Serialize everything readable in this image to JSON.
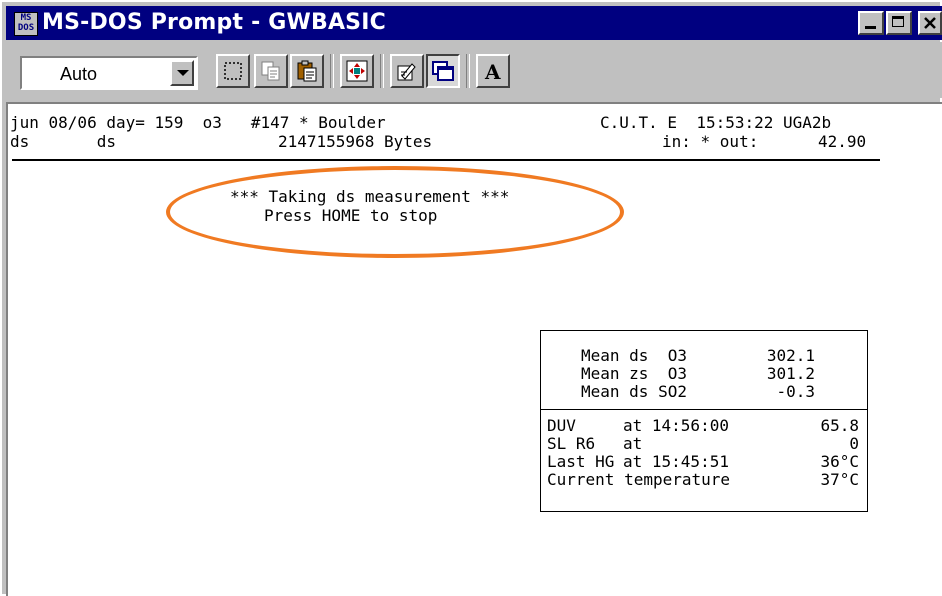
{
  "window": {
    "title": "MS-DOS Prompt - GWBASIC",
    "icon_label_top": "MS",
    "icon_label_bottom": "DOS",
    "title_bg": "#000080"
  },
  "toolbar": {
    "font_select_value": "Auto",
    "tools": [
      "mark-icon",
      "copy-icon",
      "paste-icon",
      "fullscreen-icon",
      "properties-icon",
      "background-icon",
      "font-icon"
    ],
    "font_tool_label": "A"
  },
  "status": {
    "line1_left": "jun 08/06 day= 159  o3   #147 * Boulder",
    "line1_right": "C.U.T. E  15:53:22 UGA2b",
    "line2_left": "ds       ds",
    "line2_bytes": "2147155968 Bytes",
    "line2_right": "in: * out:",
    "line2_value": "42.90"
  },
  "message": {
    "line1": "*** Taking ds measurement ***",
    "line2": "Press HOME to stop",
    "highlight_color": "#f07a22"
  },
  "panel": {
    "means": [
      {
        "label": "Mean ds  O3",
        "value": "302.1"
      },
      {
        "label": "Mean zs  O3",
        "value": "301.2"
      },
      {
        "label": "Mean ds SO2",
        "value": "-0.3"
      }
    ],
    "readings": [
      {
        "label": "DUV",
        "mid": "at 14:56:00",
        "value": "65.8"
      },
      {
        "label": "SL R6",
        "mid": "at",
        "value": "0"
      },
      {
        "label": "Last HG",
        "mid": "at 15:45:51",
        "value": "36°C"
      },
      {
        "label": "Current temperature",
        "mid": "",
        "value": "37°C"
      }
    ]
  }
}
